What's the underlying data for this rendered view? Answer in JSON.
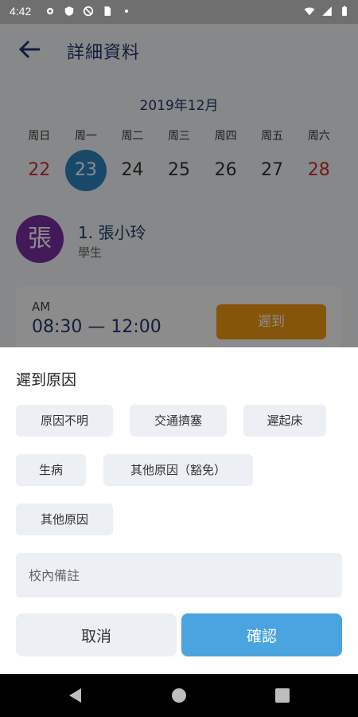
{
  "status_bar": {
    "time": "4:42",
    "left_icons": [
      "gear-icon",
      "shield-icon",
      "no-disturb-icon",
      "sim-icon",
      "dot-icon"
    ],
    "right_icons": [
      "wifi-icon",
      "signal-icon",
      "battery-icon"
    ]
  },
  "header": {
    "title": "詳細資料"
  },
  "calendar": {
    "month": "2019年12月",
    "weekdays": [
      "周日",
      "周一",
      "周二",
      "周三",
      "周四",
      "周五",
      "周六"
    ],
    "dates": [
      "22",
      "23",
      "24",
      "25",
      "26",
      "27",
      "28"
    ],
    "selected_date": "23"
  },
  "student": {
    "avatar_char": "張",
    "name": "1. 張小玲",
    "role": "學生"
  },
  "session": {
    "period": "AM",
    "time": "08:30 — 12:00",
    "status": "遲到"
  },
  "sheet": {
    "title": "遲到原因",
    "reasons": [
      "原因不明",
      "交通擠塞",
      "遲起床",
      "生病",
      "其他原因（豁免）",
      "其他原因"
    ],
    "note_placeholder": "校內備註",
    "cancel_label": "取消",
    "confirm_label": "確認"
  },
  "colors": {
    "accent": "#4aa4e0",
    "selected_date": "#2e86c1",
    "late": "#f39c12",
    "avatar": "#7b2fa5",
    "weekend": "#d32f2f"
  }
}
